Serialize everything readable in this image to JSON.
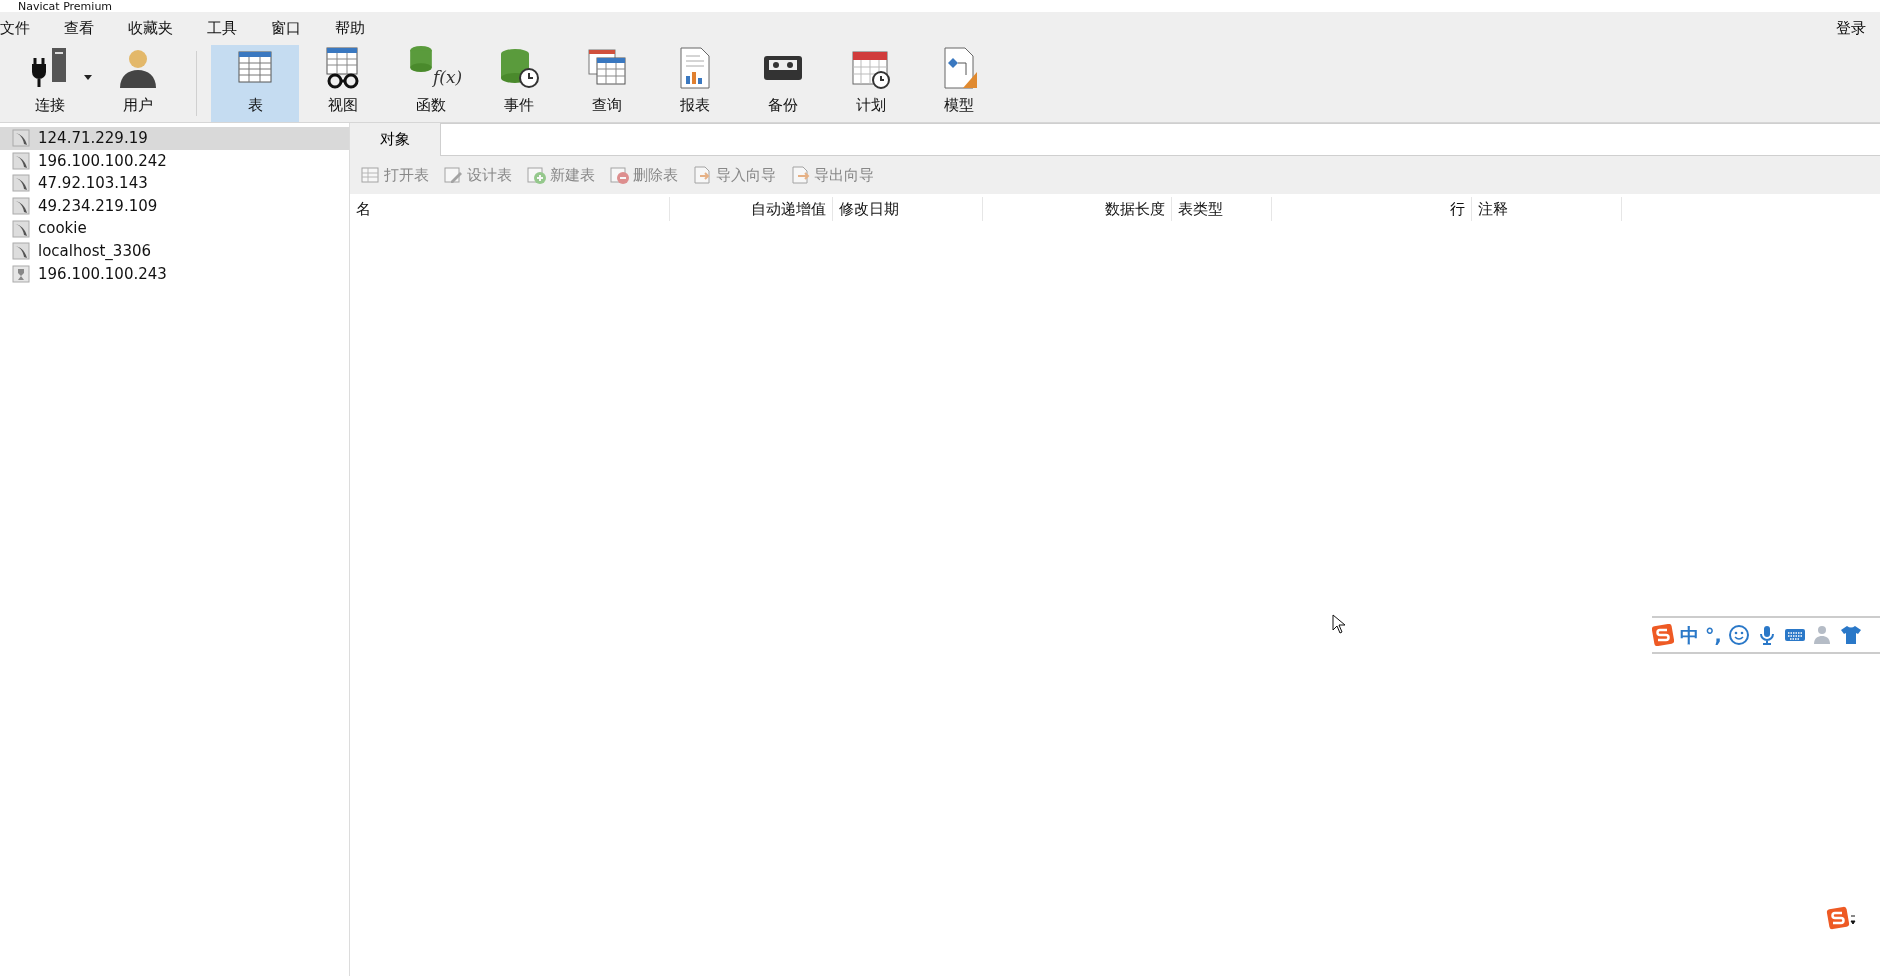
{
  "window": {
    "title": "Navicat Premium",
    "login": "登录"
  },
  "menu": [
    {
      "label": "文件"
    },
    {
      "label": "查看"
    },
    {
      "label": "收藏夹"
    },
    {
      "label": "工具"
    },
    {
      "label": "窗口"
    },
    {
      "label": "帮助"
    }
  ],
  "toolbar": [
    {
      "label": "连接",
      "selected": false,
      "dropdown": true
    },
    {
      "label": "用户",
      "selected": false,
      "dropdown": false
    },
    {
      "label": "表",
      "selected": true,
      "dropdown": false
    },
    {
      "label": "视图",
      "selected": false,
      "dropdown": false
    },
    {
      "label": "函数",
      "selected": false,
      "dropdown": false,
      "icon_text": "f(x)"
    },
    {
      "label": "事件",
      "selected": false,
      "dropdown": false
    },
    {
      "label": "查询",
      "selected": false,
      "dropdown": false
    },
    {
      "label": "报表",
      "selected": false,
      "dropdown": false
    },
    {
      "label": "备份",
      "selected": false,
      "dropdown": false
    },
    {
      "label": "计划",
      "selected": false,
      "dropdown": false
    },
    {
      "label": "模型",
      "selected": false,
      "dropdown": false
    }
  ],
  "connections": [
    {
      "name": "124.71.229.19",
      "selected": true,
      "kind": "mysql"
    },
    {
      "name": "196.100.100.242",
      "selected": false,
      "kind": "mysql"
    },
    {
      "name": "47.92.103.143",
      "selected": false,
      "kind": "mysql"
    },
    {
      "name": "49.234.219.109",
      "selected": false,
      "kind": "mysql"
    },
    {
      "name": "cookie",
      "selected": false,
      "kind": "mysql"
    },
    {
      "name": "localhost_3306",
      "selected": false,
      "kind": "mysql"
    },
    {
      "name": "196.100.100.243",
      "selected": false,
      "kind": "other"
    }
  ],
  "object_tabs": [
    {
      "label": "对象",
      "selected": true
    }
  ],
  "actions": [
    {
      "label": "打开表",
      "disabled": true
    },
    {
      "label": "设计表",
      "disabled": true
    },
    {
      "label": "新建表",
      "disabled": true
    },
    {
      "label": "删除表",
      "disabled": true
    },
    {
      "label": "导入向导",
      "disabled": true
    },
    {
      "label": "导出向导",
      "disabled": true
    }
  ],
  "table": {
    "columns": [
      {
        "label": "名"
      },
      {
        "label": "自动递增值"
      },
      {
        "label": "修改日期"
      },
      {
        "label": "数据长度"
      },
      {
        "label": "表类型"
      },
      {
        "label": "行"
      },
      {
        "label": "注释"
      }
    ]
  },
  "ime_bar": {
    "mode": "中",
    "punctuation": "°,"
  }
}
